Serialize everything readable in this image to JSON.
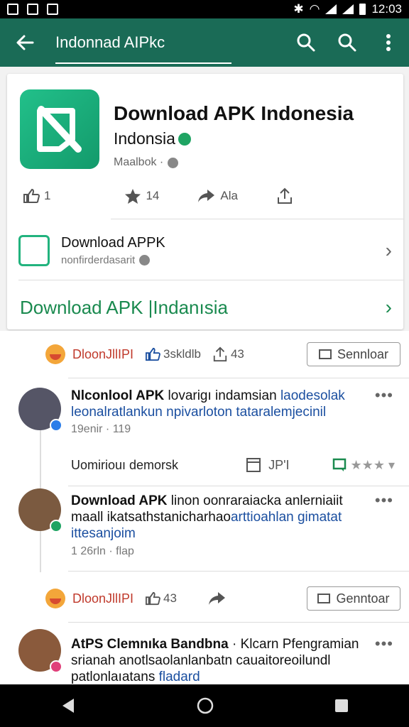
{
  "status_bar": {
    "time": "12:03"
  },
  "app_bar": {
    "search_value": "Indonnad AIPkc"
  },
  "app_card": {
    "title": "Download APK Indonesia",
    "subtitle": "Indonsia",
    "meta": "Maalbok ·",
    "actions": [
      {
        "icon": "thumbs-up-icon",
        "label": "1"
      },
      {
        "icon": "star-icon",
        "label": "14"
      },
      {
        "icon": "share-icon",
        "label": "Ala"
      },
      {
        "icon": "upload-icon",
        "label": ""
      }
    ],
    "developer": {
      "name": "Download APPK",
      "handle": "nonfirderdasarit"
    },
    "cta_label": "Download APK |Indanısia"
  },
  "feed": {
    "reaction_rows": [
      {
        "name": "DloonJllIPI",
        "likes": "3skldlb",
        "shares": "43",
        "button": "Sennloar"
      },
      {
        "name": "DloonJllIPI",
        "likes": "43",
        "shares": "",
        "button": "Genntoar"
      }
    ],
    "posts": [
      {
        "author": "Nlconlool APK",
        "text_plain": " lovarigı indamsian ",
        "text_blue": "laodesolak leonalratlankun npivarloton tataralemjecinil",
        "time": "19enir · 119",
        "sub_label": "Uomiriouı demorsk",
        "sub_pages": "JP'I"
      },
      {
        "author": "Download APK",
        "text_plain": " linon oonraraiacka anlerniaiit maall ikatsathstanicharhao",
        "text_blue": "arttioahlan gimatat ittesanjoim",
        "time": "1 26rln · flap"
      },
      {
        "author": "AtPS Clemnıka Bandbna",
        "text_plain": " · Klcarn Pfengramian srianah anotlsaolanlanbatn cauaitoreoilundl patlonlaıatans ",
        "text_blue": "fladard"
      }
    ]
  },
  "colors": {
    "appbar": "#1a6b56",
    "accent_green": "#1a8a4f",
    "link_blue": "#1b4fa0"
  }
}
